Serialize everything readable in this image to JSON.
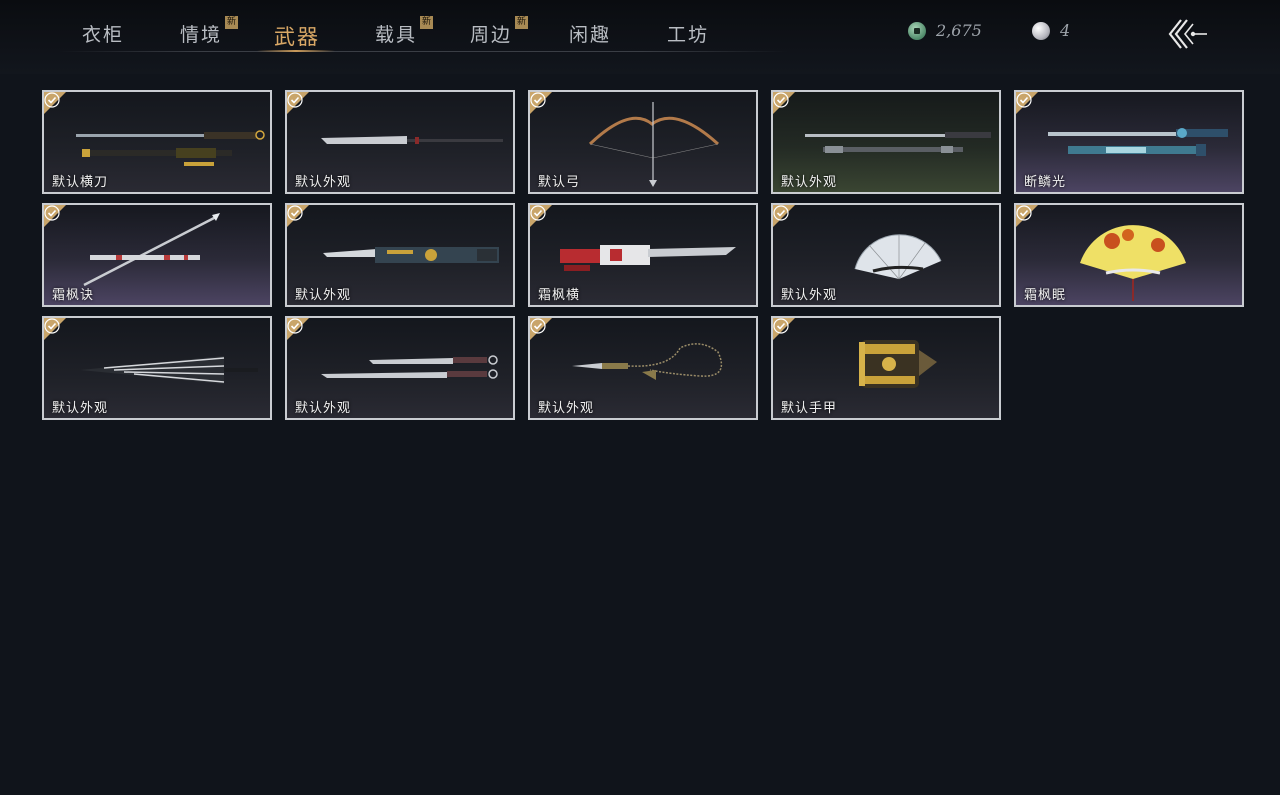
{
  "tabs": [
    {
      "label": "衣柜",
      "new": false,
      "badge": ""
    },
    {
      "label": "情境",
      "new": true,
      "badge": "新"
    },
    {
      "label": "武器",
      "new": false,
      "badge": "",
      "active": true
    },
    {
      "label": "载具",
      "new": true,
      "badge": "新"
    },
    {
      "label": "周边",
      "new": true,
      "badge": "新"
    },
    {
      "label": "闲趣",
      "new": false,
      "badge": ""
    },
    {
      "label": "工坊",
      "new": false,
      "badge": ""
    }
  ],
  "currency": {
    "coins": "2,675",
    "pearls": "4",
    "coin_icon": "jade-coin-icon",
    "pearl_icon": "pearl-icon"
  },
  "colors": {
    "accent": "#d9a866",
    "background": "#10141b",
    "card_border": "#c9ccd1",
    "check_badge": "#c9a56a"
  },
  "items": [
    {
      "label": "默认横刀",
      "weapon": "horizontal-blade"
    },
    {
      "label": "默认外观",
      "weapon": "long-sword"
    },
    {
      "label": "默认弓",
      "weapon": "bow"
    },
    {
      "label": "默认外观",
      "weapon": "twin-swords"
    },
    {
      "label": "断鳞光",
      "weapon": "ornate-blade"
    },
    {
      "label": "霜枫诀",
      "weapon": "spear"
    },
    {
      "label": "默认外观",
      "weapon": "mechanical-blade"
    },
    {
      "label": "霜枫横",
      "weapon": "red-mechanical-blade"
    },
    {
      "label": "默认外观",
      "weapon": "fan"
    },
    {
      "label": "霜枫眠",
      "weapon": "maple-fan"
    },
    {
      "label": "默认外观",
      "weapon": "umbrella"
    },
    {
      "label": "默认外观",
      "weapon": "dual-daggers"
    },
    {
      "label": "默认外观",
      "weapon": "rope-dart"
    },
    {
      "label": "默认手甲",
      "weapon": "gauntlet"
    }
  ]
}
